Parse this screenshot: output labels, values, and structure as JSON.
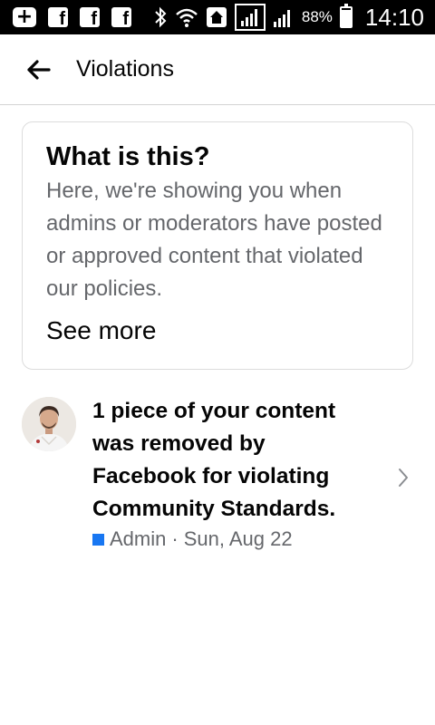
{
  "status_bar": {
    "battery_percent": "88%",
    "time": "14:10",
    "facebook_letter": "f",
    "icons": [
      "add-box-icon",
      "facebook-icon",
      "facebook-icon",
      "facebook-icon",
      "bluetooth-icon",
      "wifi-icon",
      "home-icon",
      "signal-icon",
      "signal-icon",
      "battery-icon"
    ]
  },
  "header": {
    "title": "Violations",
    "back_icon": "arrow-left-icon"
  },
  "info_card": {
    "title": "What is this?",
    "body": "Here, we're showing you when admins or moderators have posted or approved content that violated our policies.",
    "see_more": "See more"
  },
  "notification": {
    "text": "1 piece of your content was removed by Facebook for violating Community Standards.",
    "role": "Admin",
    "separator": "·",
    "date": "Sun, Aug 22",
    "role_color": "#1877f2"
  },
  "colors": {
    "primary_text": "#050505",
    "secondary_text": "#65676b",
    "accent": "#1877f2",
    "divider": "#d4d4d4"
  }
}
